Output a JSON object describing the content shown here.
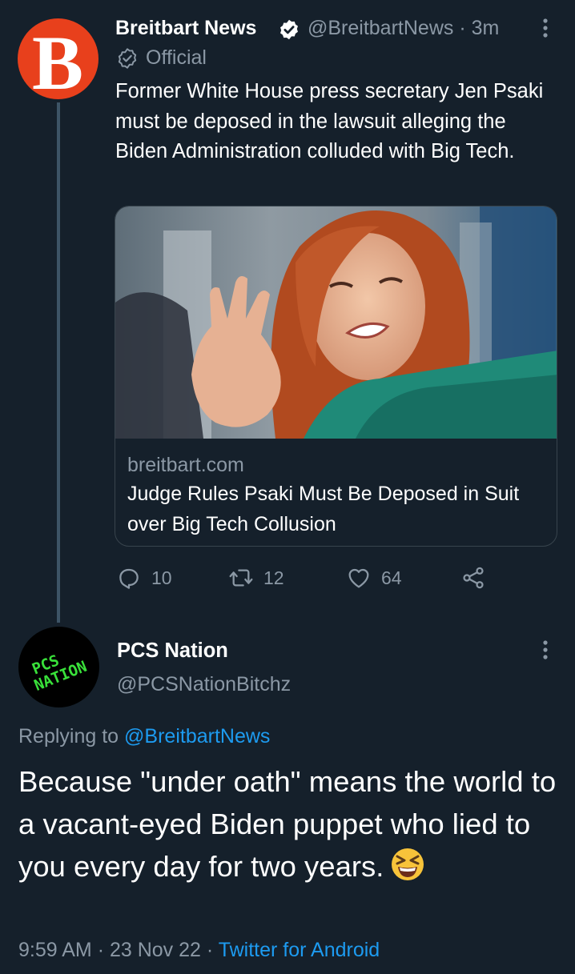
{
  "tweet1": {
    "avatar_letter": "B",
    "name": "Breitbart News",
    "handle": "@BreitbartNews",
    "separator": "·",
    "time": "3m",
    "official_label": "Official",
    "text": "Former White House press secretary Jen Psaki must be deposed in the lawsuit alleging the Biden Administration colluded with Big Tech.",
    "card": {
      "domain": "breitbart.com",
      "title": "Judge Rules Psaki Must Be Deposed in Suit over Big Tech Collusion"
    },
    "actions": {
      "replies": "10",
      "retweets": "12",
      "likes": "64"
    }
  },
  "tweet2": {
    "avatar_text_line1": "PCS",
    "avatar_text_line2": "NATION",
    "name": "PCS Nation",
    "handle": "@PCSNationBitchz",
    "replying_prefix": "Replying to",
    "replying_to": "@BreitbartNews",
    "text": "Because \"under oath\" means the world to a vacant-eyed Biden puppet who lied to you every day for two years.",
    "emoji": "grinning-squinting-face",
    "time": "9:59 AM",
    "sep1": "·",
    "date": "23 Nov 22",
    "sep2": "·",
    "source": "Twitter for Android"
  },
  "colors": {
    "background": "#15202b",
    "secondary_text": "#8b98a5",
    "link": "#1d9bf0",
    "brand_red": "#e8401c",
    "avatar_green": "#39e03a"
  }
}
